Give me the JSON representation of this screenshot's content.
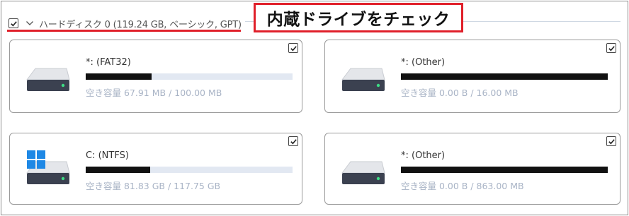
{
  "disk": {
    "label": "ハードディスク 0 (119.24 GB, ベーシック, GPT)",
    "checked": true
  },
  "callout": {
    "text": "内蔵ドライブをチェック",
    "border_color": "#e0202a"
  },
  "partitions": [
    {
      "title": "*: (FAT32)",
      "usage": "空き容量 67.91 MB / 100.00 MB",
      "used_fraction": 0.32,
      "checked": true,
      "windows_icon": false
    },
    {
      "title": "*: (Other)",
      "usage": "空き容量 0.00 B / 16.00 MB",
      "used_fraction": 1.0,
      "checked": true,
      "windows_icon": false
    },
    {
      "title": "C: (NTFS)",
      "usage": "空き容量 81.83 GB / 117.75 GB",
      "used_fraction": 0.31,
      "checked": true,
      "windows_icon": true
    },
    {
      "title": "*: (Other)",
      "usage": "空き容量 0.00 B / 863.00 MB",
      "used_fraction": 1.0,
      "checked": true,
      "windows_icon": false
    }
  ],
  "icons": {
    "checkbox": "checkbox-checked-icon",
    "chevron": "chevron-down-icon",
    "drive": "hard-drive-icon",
    "windows": "windows-logo-icon"
  },
  "colors": {
    "bar_fill": "#111111",
    "bar_track": "#e2e8f2",
    "usage_text": "#a9b4c6",
    "windows_blue": "#1e88e5"
  }
}
